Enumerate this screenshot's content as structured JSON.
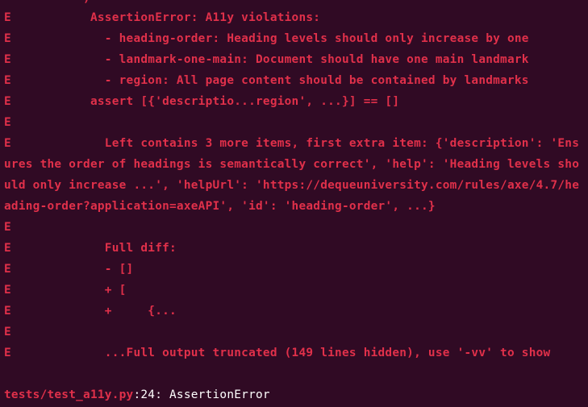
{
  "terminal": {
    "lines": [
      {
        "text": "E           AssertionError: A11y violations:"
      },
      {
        "text": "E             - heading-order: Heading levels should only increase by one"
      },
      {
        "text": "E             - landmark-one-main: Document should have one main landmark"
      },
      {
        "text": "E             - region: All page content should be contained by landmarks"
      },
      {
        "text": "E           assert [{'descriptio...region', ...}] == []"
      },
      {
        "text": "E"
      },
      {
        "text": "E             Left contains 3 more items, first extra item: {'description': 'Ens"
      },
      {
        "text": "ures the order of headings is semantically correct', 'help': 'Heading levels sho"
      },
      {
        "text": "uld only increase ...', 'helpUrl': 'https://dequeuniversity.com/rules/axe/4.7/he"
      },
      {
        "text": "ading-order?application=axeAPI', 'id': 'heading-order', ...}"
      },
      {
        "text": "E"
      },
      {
        "text": "E             Full diff:"
      },
      {
        "text": "E             - []"
      },
      {
        "text": "E             + ["
      },
      {
        "text": "E             +     {..."
      },
      {
        "text": "E"
      },
      {
        "text": "E             ...Full output truncated (149 lines hidden), use '-vv' to show"
      }
    ],
    "footer": {
      "path": "tests/test_a11y.py",
      "line_suffix": ":24: AssertionError"
    }
  }
}
